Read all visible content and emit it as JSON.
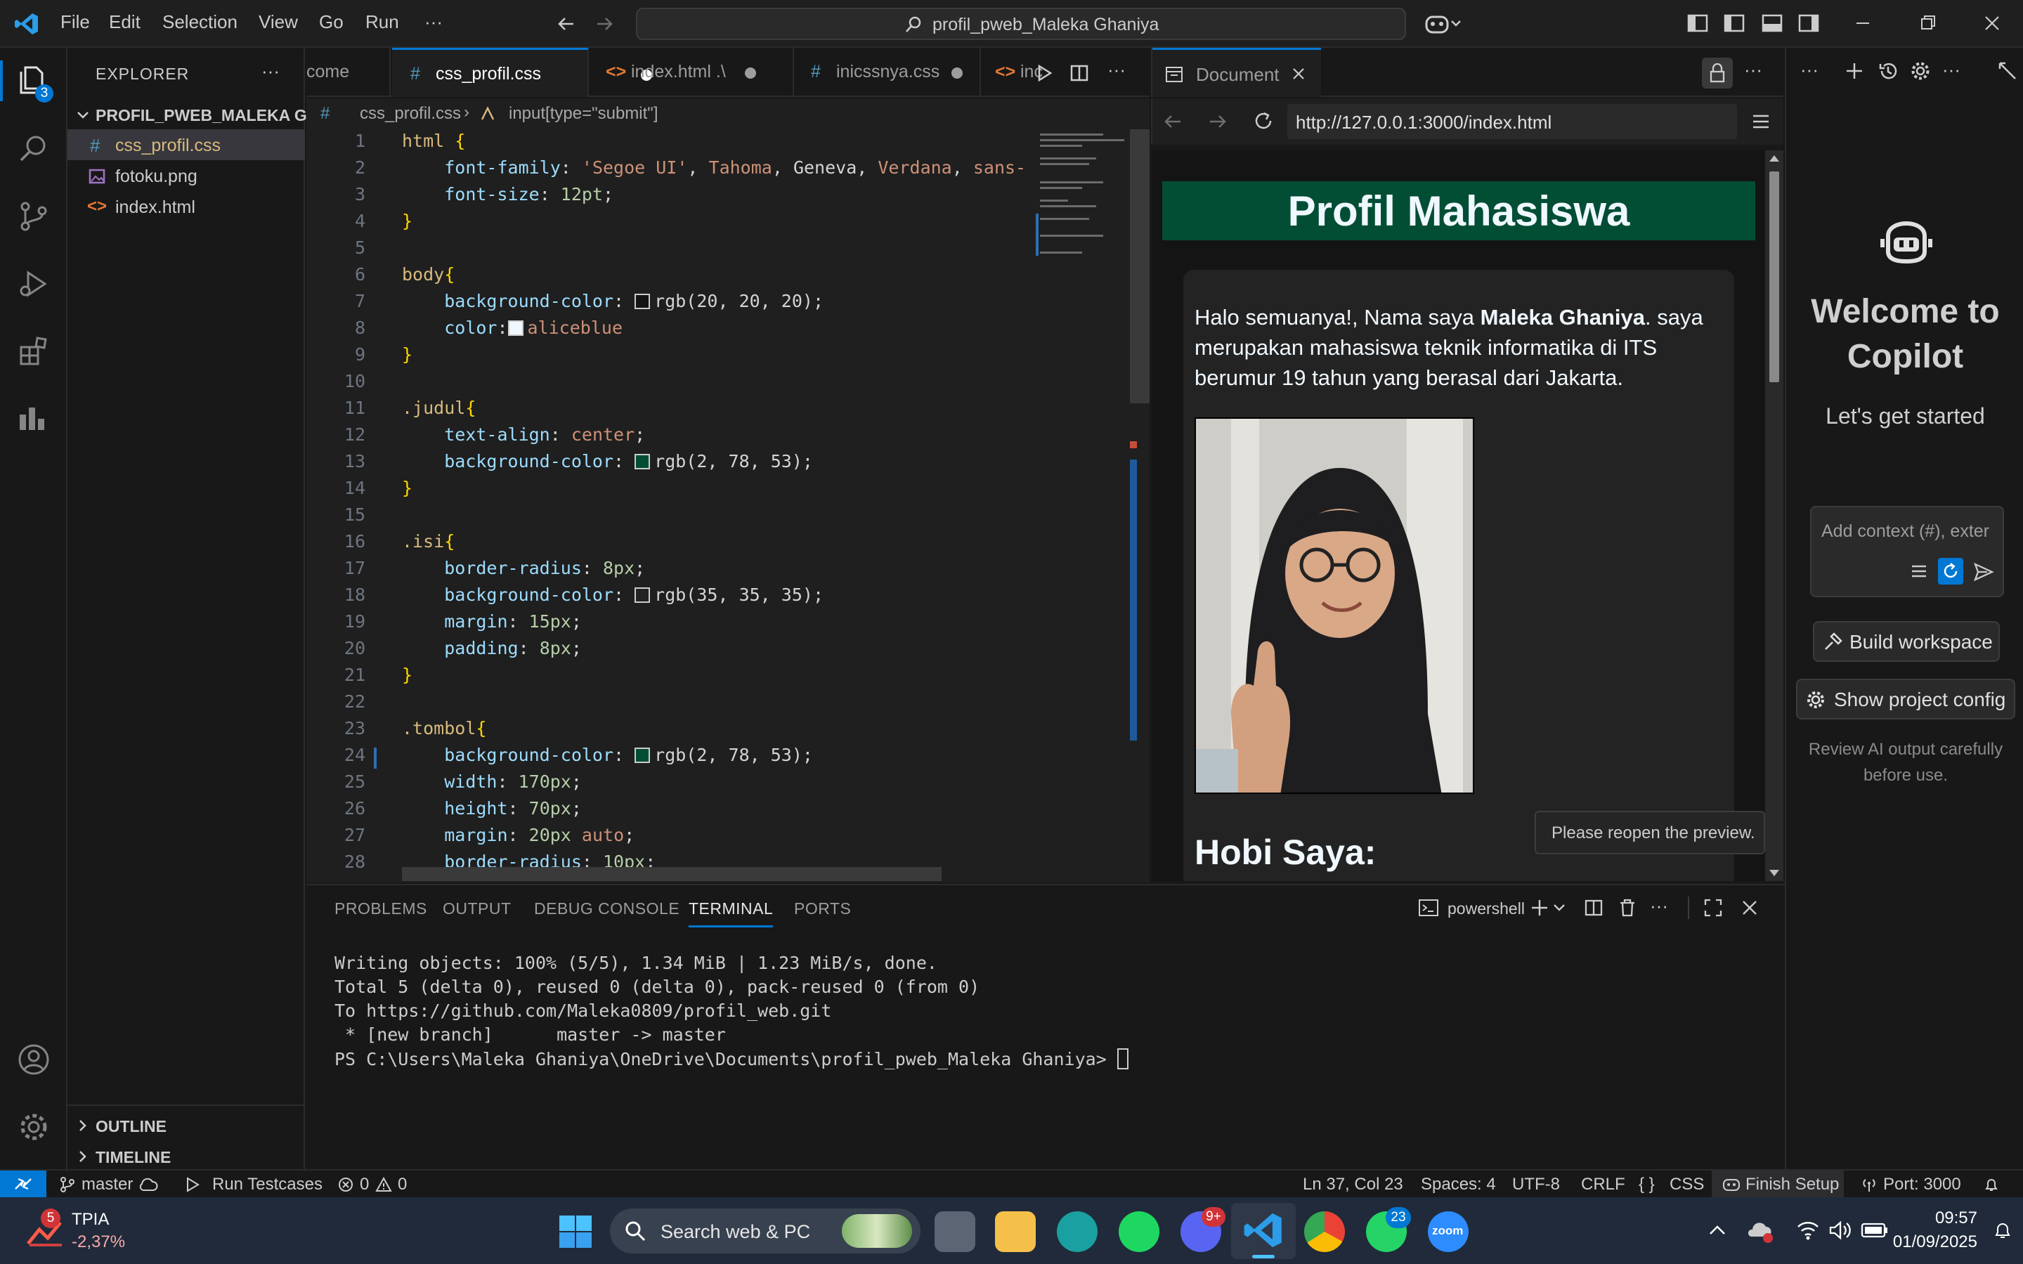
{
  "titlebar": {
    "menus": [
      "File",
      "Edit",
      "Selection",
      "View",
      "Go",
      "Run",
      "···"
    ],
    "search_text": "profil_pweb_Maleka Ghaniya"
  },
  "activity": {
    "explorer_badge": "3"
  },
  "sidebar": {
    "title": "EXPLORER",
    "folder": "PROFIL_PWEB_MALEKA G...",
    "files": [
      {
        "icon": "#",
        "name": "css_profil.css"
      },
      {
        "icon": "img",
        "name": "fotoku.png"
      },
      {
        "icon": "<>",
        "name": "index.html"
      }
    ],
    "outline": "OUTLINE",
    "timeline": "TIMELINE"
  },
  "tabs": [
    {
      "label": "come"
    },
    {
      "label": "css_profil.css",
      "icon": "#"
    },
    {
      "label": "index.html .\\",
      "icon": "<>"
    },
    {
      "label": "inicssnya.css",
      "icon": "#"
    },
    {
      "label": "inc",
      "icon": "<>"
    }
  ],
  "breadcrumb": {
    "file": "css_profil.css",
    "symbol": "input[type=\"submit\"]"
  },
  "code_lines": [
    {
      "n": "1"
    },
    {
      "n": "2"
    },
    {
      "n": "3"
    },
    {
      "n": "4"
    },
    {
      "n": "5"
    },
    {
      "n": "6"
    },
    {
      "n": "7"
    },
    {
      "n": "8"
    },
    {
      "n": "9"
    },
    {
      "n": "10"
    },
    {
      "n": "11"
    },
    {
      "n": "12"
    },
    {
      "n": "13"
    },
    {
      "n": "14"
    },
    {
      "n": "15"
    },
    {
      "n": "16"
    },
    {
      "n": "17"
    },
    {
      "n": "18"
    },
    {
      "n": "19"
    },
    {
      "n": "20"
    },
    {
      "n": "21"
    },
    {
      "n": "22"
    },
    {
      "n": "23"
    },
    {
      "n": "24"
    },
    {
      "n": "25"
    },
    {
      "n": "26"
    },
    {
      "n": "27"
    },
    {
      "n": "28"
    }
  ],
  "code": {
    "l1_sel": "html",
    "l1_br": "{",
    "l2_prop": "font-family",
    "l2_v1": "'Segoe UI'",
    "l2_v2": "Tahoma",
    "l2_v3": "Geneva",
    "l2_v4": "Verdana",
    "l2_v5": "sans-",
    "l3_prop": "font-size",
    "l3_val": "12pt",
    "l6_sel": "body",
    "l7_prop": "background-color",
    "l7_val": "rgb(20, 20, 20)",
    "l8_prop": "color",
    "l8_val": "aliceblue",
    "l11_sel": ".judul",
    "l12_prop": "text-align",
    "l12_val": "center",
    "l13_prop": "background-color",
    "l13_val": "rgb(2, 78, 53)",
    "l16_sel": ".isi",
    "l17_prop": "border-radius",
    "l17_val": "8px",
    "l18_prop": "background-color",
    "l18_val": "rgb(35, 35, 35)",
    "l19_prop": "margin",
    "l19_val": "15px",
    "l20_prop": "padding",
    "l20_val": "8px",
    "l23_sel": ".tombol",
    "l24_prop": "background-color",
    "l24_val": "rgb(2, 78, 53)",
    "l25_prop": "width",
    "l25_val": "170px",
    "l26_prop": "height",
    "l26_val": "70px",
    "l27_prop": "margin",
    "l27_val": "20px",
    "l27_val2": "auto",
    "l28_prop": "border-radius",
    "l28_val": "10px"
  },
  "preview": {
    "tab_label": "Document",
    "url": "http://127.0.0.1:3000/index.html",
    "heading": "Profil Mahasiswa",
    "intro_before": "Halo semuanya!, Nama saya ",
    "intro_name": "Maleka Ghaniya",
    "intro_after": ". saya merupakan mahasiswa teknik informatika di ITS berumur 19 tahun yang berasal dari Jakarta.",
    "hobby_heading": "Hobi Saya:",
    "tooltip": "Please reopen the preview."
  },
  "copilot": {
    "welcome": "Welcome to Copilot",
    "subtitle": "Let's get started",
    "input_placeholder": "Add context (#), exter",
    "build_label": "Build workspace",
    "config_label": "Show project config",
    "note": "Review AI output carefully before use."
  },
  "panel": {
    "tabs": [
      "PROBLEMS",
      "OUTPUT",
      "DEBUG CONSOLE",
      "TERMINAL",
      "PORTS"
    ],
    "shell": "powershell",
    "lines": [
      "Writing objects: 100% (5/5), 1.34 MiB | 1.23 MiB/s, done.",
      "Total 5 (delta 0), reused 0 (delta 0), pack-reused 0 (from 0)",
      "To https://github.com/Maleka0809/profil_web.git",
      " * [new branch]      master -> master",
      "PS C:\\Users\\Maleka Ghaniya\\OneDrive\\Documents\\profil_pweb_Maleka Ghaniya> "
    ]
  },
  "status": {
    "branch": "master",
    "run": "Run Testcases",
    "errors": "0",
    "warnings": "0",
    "position": "Ln 37, Col 23",
    "spaces": "Spaces: 4",
    "encoding": "UTF-8",
    "eol": "CRLF",
    "lang": "CSS",
    "finish": "Finish Setup",
    "port": "Port: 3000"
  },
  "taskbar": {
    "weather_badge": "5",
    "weather_name": "TPIA",
    "weather_change": "-2,37%",
    "search": "Search web & PC",
    "discord_badge": "9+",
    "whatsapp_badge": "23",
    "zoom_label": "zoom",
    "time": "09:57",
    "date": "01/09/2025"
  },
  "colors": {
    "accent": "#0078d4",
    "judul_bg": "#024e35",
    "vscode_blue": "#0078d4"
  }
}
